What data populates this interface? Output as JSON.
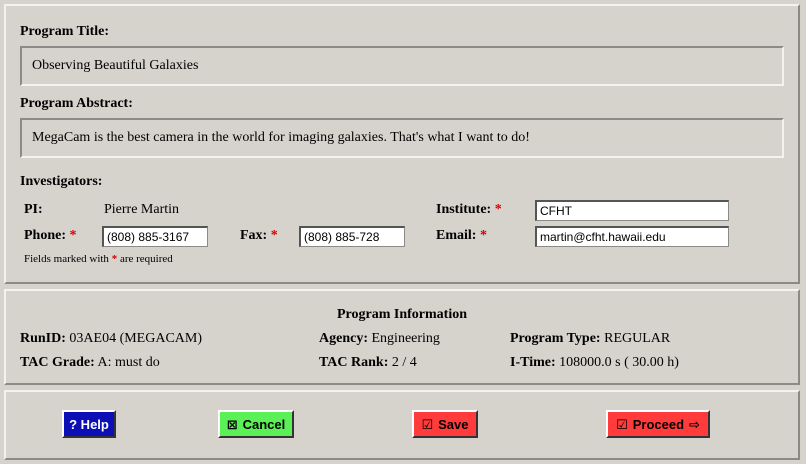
{
  "title_section": {
    "label": "Program Title:",
    "value": "Observing Beautiful Galaxies"
  },
  "abstract_section": {
    "label": "Program Abstract:",
    "value": "MegaCam is the best camera in the world for imaging galaxies. That's what I want to do!"
  },
  "investigators": {
    "label": "Investigators:",
    "pi_label": "PI:",
    "pi_value": "Pierre Martin",
    "institute_label": "Institute:",
    "institute_value": "CFHT",
    "phone_label": "Phone:",
    "phone_value": "(808) 885-3167",
    "fax_label": "Fax:",
    "fax_value": "(808) 885-728",
    "email_label": "Email:",
    "email_value": "martin@cfht.hawaii.edu",
    "required_mark": "*",
    "note_prefix": "Fields marked with",
    "note_suffix": "are required"
  },
  "program_info": {
    "heading": "Program Information",
    "runid_label": "RunID:",
    "runid_value": "03AE04 (MEGACAM)",
    "agency_label": "Agency:",
    "agency_value": "Engineering",
    "type_label": "Program Type:",
    "type_value": "REGULAR",
    "grade_label": "TAC Grade:",
    "grade_value": "A: must do",
    "rank_label": "TAC Rank:",
    "rank_value": "2 / 4",
    "itime_label": "I-Time:",
    "itime_value": "108000.0 s ( 30.00 h)"
  },
  "buttons": {
    "help": "? Help",
    "cancel": "Cancel",
    "cancel_icon": "⊠",
    "save": "Save",
    "save_icon": "☑",
    "proceed": "Proceed",
    "proceed_icon": "☑",
    "proceed_arrow": "⇨"
  },
  "colors": {
    "help_bg": "#0b0fb5",
    "cancel_bg": "#5cf058",
    "save_bg": "#ff3b3b",
    "proceed_bg": "#ff3b3b",
    "required": "#d40000"
  }
}
